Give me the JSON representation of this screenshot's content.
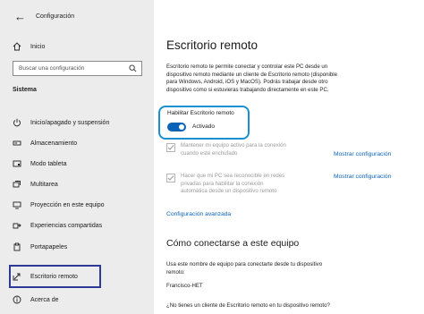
{
  "window": {
    "title": "Configuración",
    "back_icon": "back-arrow-icon",
    "minimize": "—",
    "maximize": "☐",
    "close": "✕"
  },
  "sidebar": {
    "home_label": "Inicio",
    "search_placeholder": "Buscar una configuración",
    "section": "Sistema",
    "items": [
      {
        "label": "Inicio/apagado y suspensión",
        "icon": "power-icon"
      },
      {
        "label": "Almacenamiento",
        "icon": "storage-icon"
      },
      {
        "label": "Modo tableta",
        "icon": "tablet-icon"
      },
      {
        "label": "Multitarea",
        "icon": "multitasking-icon"
      },
      {
        "label": "Proyección en este equipo",
        "icon": "projection-icon"
      },
      {
        "label": "Experiencias compartidas",
        "icon": "shared-experiences-icon"
      },
      {
        "label": "Portapapeles",
        "icon": "clipboard-icon"
      },
      {
        "label": "Escritorio remoto",
        "icon": "remote-desktop-icon"
      },
      {
        "label": "Acerca de",
        "icon": "info-icon"
      }
    ],
    "highlight_color": "#2e3896"
  },
  "main": {
    "title": "Escritorio remoto",
    "description": [
      "Escritorio remoto te permite conectar y controlar este PC desde un",
      "dispositivo remoto mediante un cliente de Escritorio remoto (disponible",
      "para Windows, Android, iOS y MacOS). Podrás trabajar desde otro",
      "dispositivo como si estuvieras trabajando directamente en este PC."
    ],
    "toggle": {
      "label": "Habilitar Escritorio remoto",
      "state": "Activado",
      "on": true,
      "accent": "#0b63b8",
      "highlight_color": "#1791cf"
    },
    "options": [
      {
        "lines": [
          "Mantener mi equipo activo para la conexión",
          "cuando esté enchufado"
        ],
        "checked": true,
        "link": "Mostrar configuración"
      },
      {
        "lines": [
          "Hacer que mi PC sea reconocible en redes",
          "privadas para habilitar la conexión",
          "automática desde un dispositivo remoto"
        ],
        "checked": true,
        "link": "Mostrar configuración"
      }
    ],
    "advanced_link": "Configuración avanzada",
    "connect": {
      "heading": "Cómo conectarse a este equipo",
      "text": [
        "Usa este nombre de equipo para conectarte desde tu dispositivo",
        "remoto:"
      ],
      "pc_name": "Francisco-HET",
      "footer": "¿No tienes un cliente de Escritorio remoto en tu dispositivo remoto?"
    }
  }
}
